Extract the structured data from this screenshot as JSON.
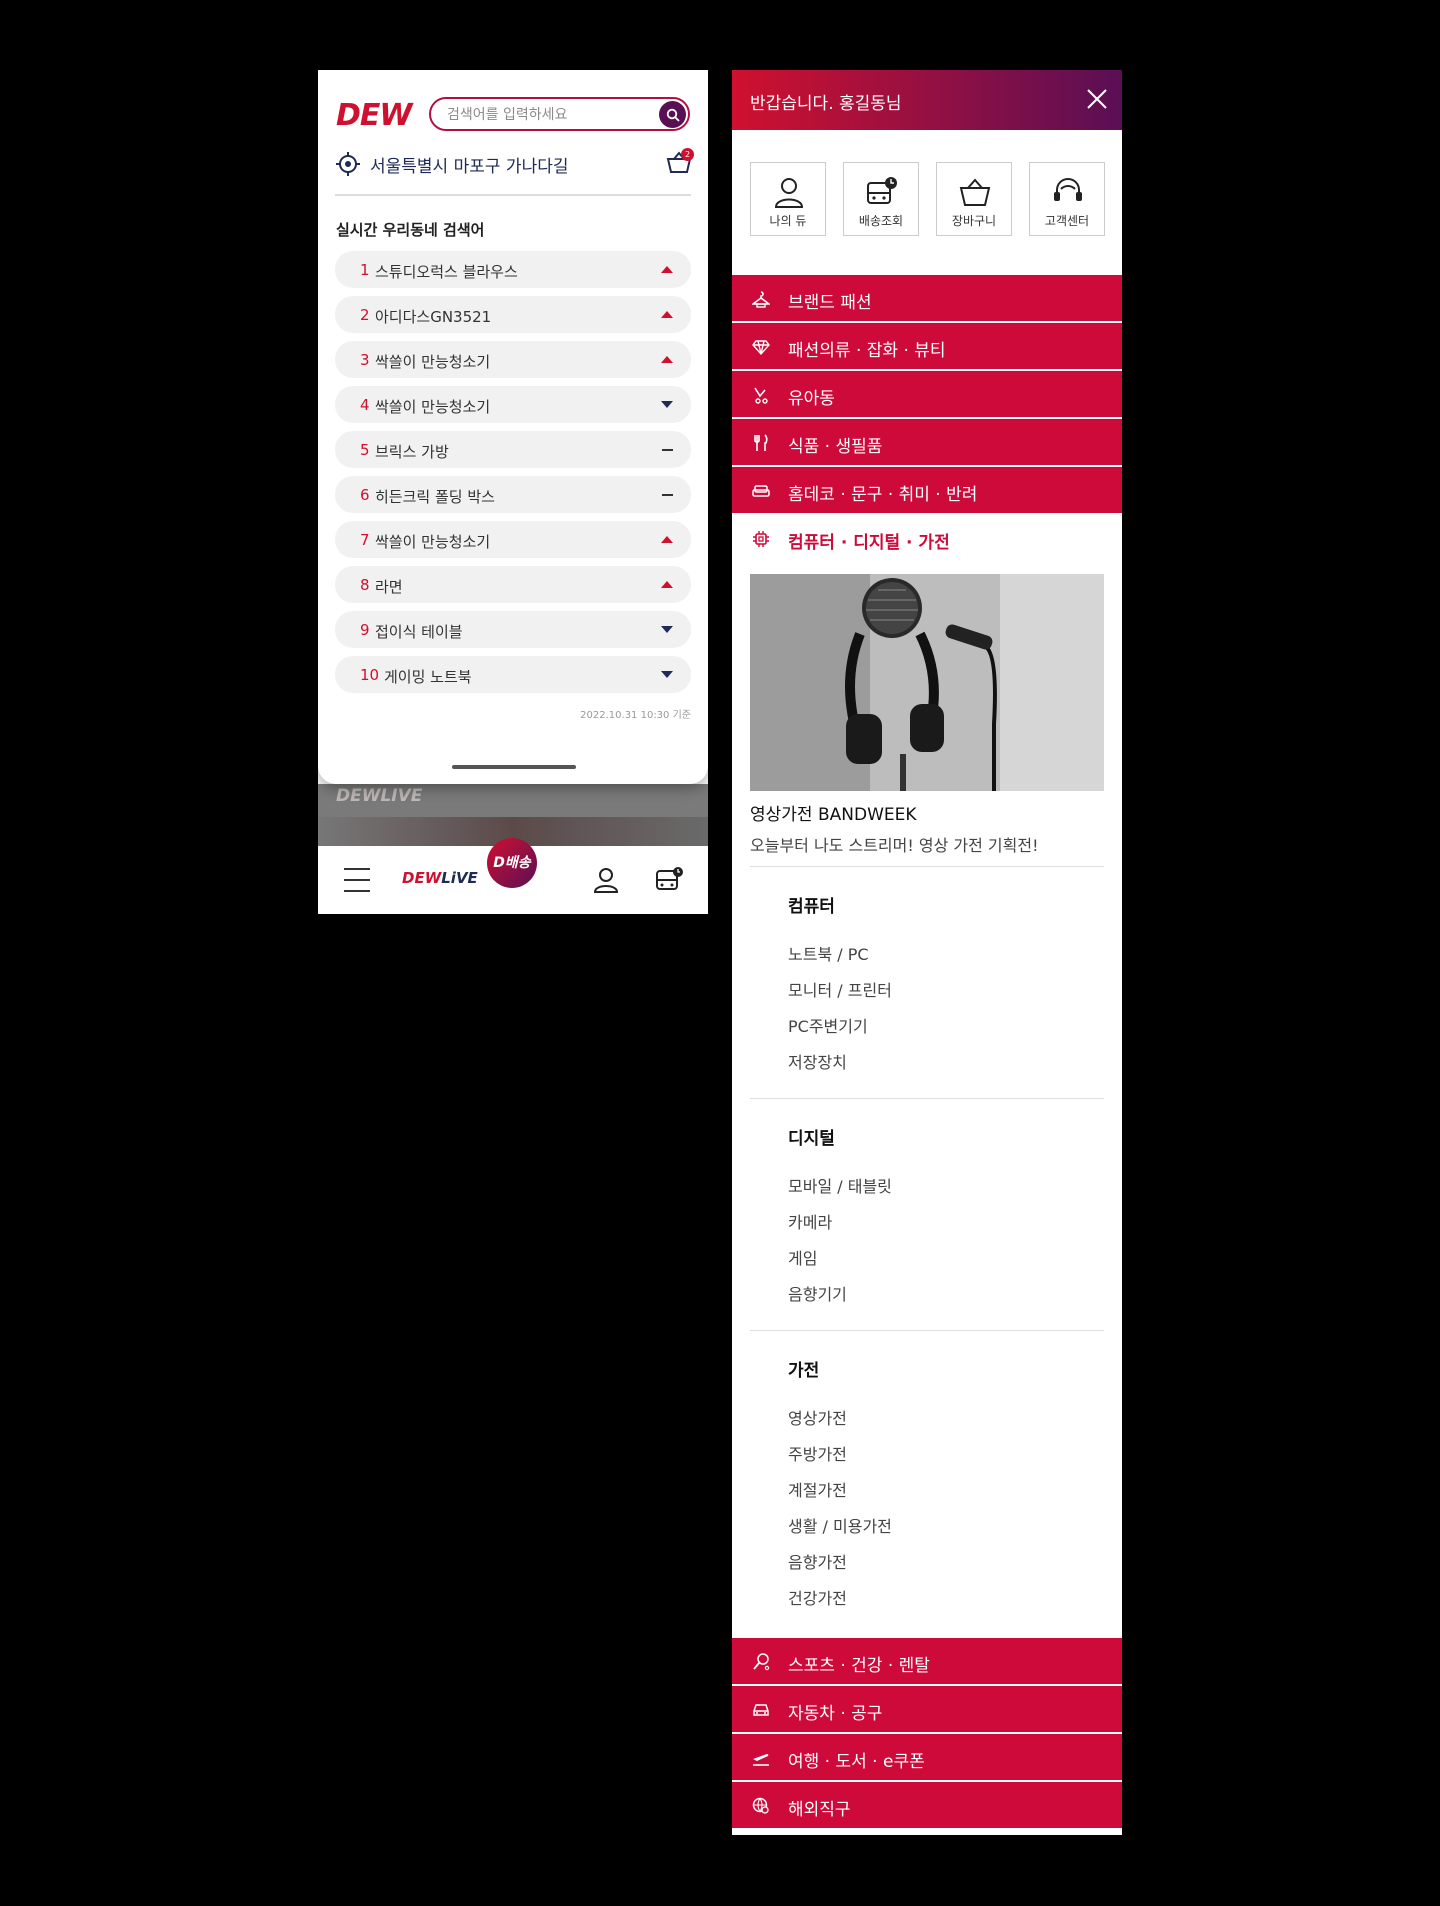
{
  "left_phone": {
    "logo": "DEW",
    "search": {
      "placeholder": "검색어를 입력하세요"
    },
    "location": "서울특별시 마포구 가나다길",
    "cart_count": "2",
    "ranking": {
      "title": "실시간 우리동네 검색어",
      "items": [
        {
          "rank": "1",
          "label": "스튜디오럭스 블라우스",
          "trend": "up"
        },
        {
          "rank": "2",
          "label": "아디다스GN3521",
          "trend": "up"
        },
        {
          "rank": "3",
          "label": "싹쓸이 만능청소기",
          "trend": "up"
        },
        {
          "rank": "4",
          "label": "싹쓸이 만능청소기",
          "trend": "down"
        },
        {
          "rank": "5",
          "label": "브릭스 가방",
          "trend": "flat"
        },
        {
          "rank": "6",
          "label": "히든크릭 폴딩 박스",
          "trend": "flat"
        },
        {
          "rank": "7",
          "label": "싹쓸이 만능청소기",
          "trend": "up"
        },
        {
          "rank": "8",
          "label": "라면",
          "trend": "up"
        },
        {
          "rank": "9",
          "label": "접이식 테이블",
          "trend": "down"
        },
        {
          "rank": "10",
          "label": "게이밍 노트북",
          "trend": "down"
        }
      ],
      "basis": "2022.10.31 10:30 기준"
    },
    "background_label": "DEWLIVE",
    "tabbar": {
      "live_a": "DEW",
      "live_b": "LiVE",
      "delivery": "D배송"
    }
  },
  "drawer": {
    "greeting": "반갑습니다. 홍길동님",
    "quick_links": [
      "나의 듀",
      "배송조회",
      "장바구니",
      "고객센터"
    ],
    "categories_top": [
      "브랜드 패션",
      "패션의류 · 잡화 · 뷰티",
      "유아동",
      "식품 · 생필품",
      "홈데코 · 문구 · 취미 · 반려"
    ],
    "active_category": "컴퓨터 · 디지털 · 가전",
    "banner": {
      "title": "영상가전 BANDWEEK",
      "subtitle": "오늘부터 나도 스트리머! 영상 가전 기획전!"
    },
    "groups": [
      {
        "title": "컴퓨터",
        "items": [
          "노트북 / PC",
          "모니터 / 프린터",
          "PC주변기기",
          "저장장치"
        ]
      },
      {
        "title": "디지털",
        "items": [
          "모바일 / 태블릿",
          "카메라",
          "게임",
          "음향기기"
        ]
      },
      {
        "title": "가전",
        "items": [
          "영상가전",
          "주방가전",
          "계절가전",
          "생활 / 미용가전",
          "음향가전",
          "건강가전"
        ]
      }
    ],
    "categories_bottom": [
      "스포츠 · 건강 · 렌탈",
      "자동차 · 공구",
      "여행 · 도서 · e쿠폰",
      "해외직구"
    ]
  },
  "colors": {
    "brand_red": "#cd0a3a",
    "brand_purple": "#5a0f55",
    "navy": "#1f2a55"
  }
}
